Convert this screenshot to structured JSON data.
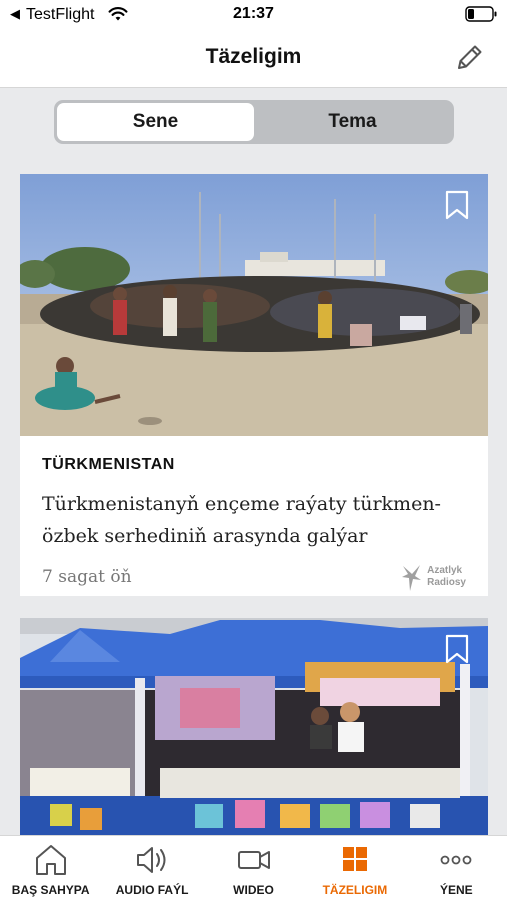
{
  "status_bar": {
    "back_glyph": "◀",
    "app": "TestFlight",
    "time": "21:37",
    "icons": [
      "wifi-icon",
      "battery-icon"
    ]
  },
  "header": {
    "title": "Täzeligim",
    "edit_icon": "pencil-icon"
  },
  "segments": [
    {
      "label": "Sene",
      "selected": true
    },
    {
      "label": "Tema",
      "selected": false
    }
  ],
  "articles": [
    {
      "category": "TÜRKMENISTAN",
      "headline": "Türkmenistanyň ençeme raýaty türkmen-özbek serhediniň arasynda galýar",
      "time": "7 sagat öň",
      "source_logo": [
        "Azatlyk",
        "Radiosy"
      ],
      "bookmark_icon": "bookmark-icon"
    },
    {
      "bookmark_icon": "bookmark-icon"
    }
  ],
  "tabs": [
    {
      "label": "BAŞ SAHYPA",
      "icon": "home-icon",
      "active": false
    },
    {
      "label": "AUDIO FAÝL",
      "icon": "speaker-icon",
      "active": false
    },
    {
      "label": "WIDEO",
      "icon": "video-camera-icon",
      "active": false
    },
    {
      "label": "TÄZELIGIM",
      "icon": "grid-icon",
      "active": true
    },
    {
      "label": "ÝENE",
      "icon": "more-dots-icon",
      "active": false
    }
  ],
  "colors": {
    "accent": "#ea6903",
    "background": "#e9eaec",
    "segment_track": "#bdbfc2"
  }
}
